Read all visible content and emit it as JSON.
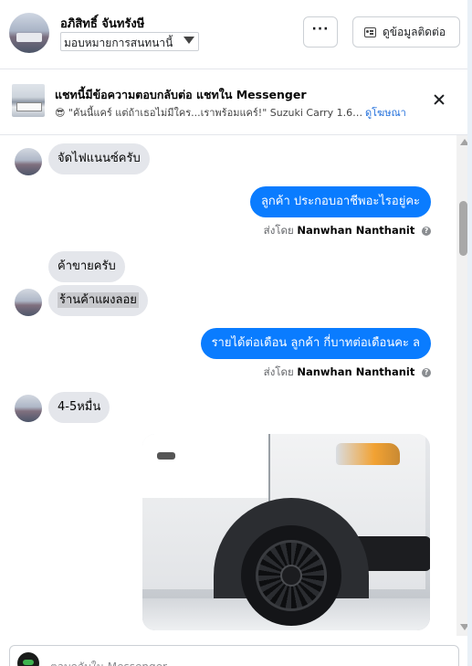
{
  "header": {
    "name": "อภิสิทธิ์ จันทรังษี",
    "assign_value": "มอบหมายการสนทนานี้",
    "more_label": "···",
    "contact_label": "ดูข้อมูลติดต่อ"
  },
  "ad": {
    "title": "แชทนี้มีข้อความตอบกลับต่อ แชทใน Messenger",
    "emoji": "😎",
    "snippet": "\"คันนี้แคร์ แต่ถ้าเธอไม่มีใคร...เราพร้อมแคร์!\" Suzuki Carry 1.6 (LPG) M...",
    "link_label": "ดูโฆษณา"
  },
  "messages": {
    "m1": "จัดไฟแนนซ์ครับ",
    "m2": "ลูกค้า ประกอบอาชีพอะไรอยู่คะ",
    "m3": "ค้าขายครับ",
    "m4": "ร้านค้าแผงลอย",
    "m5": "รายได้ต่อเดือน  ลูกค้า กี่บาทต่อเดือนคะ  ล",
    "m6": "4-5หมื่น"
  },
  "sent_by": {
    "prefix": "ส่งโดย",
    "name": "Nanwhan Nanthanit"
  },
  "composer": {
    "placeholder": "ตอบกลับใน Messenger..."
  }
}
